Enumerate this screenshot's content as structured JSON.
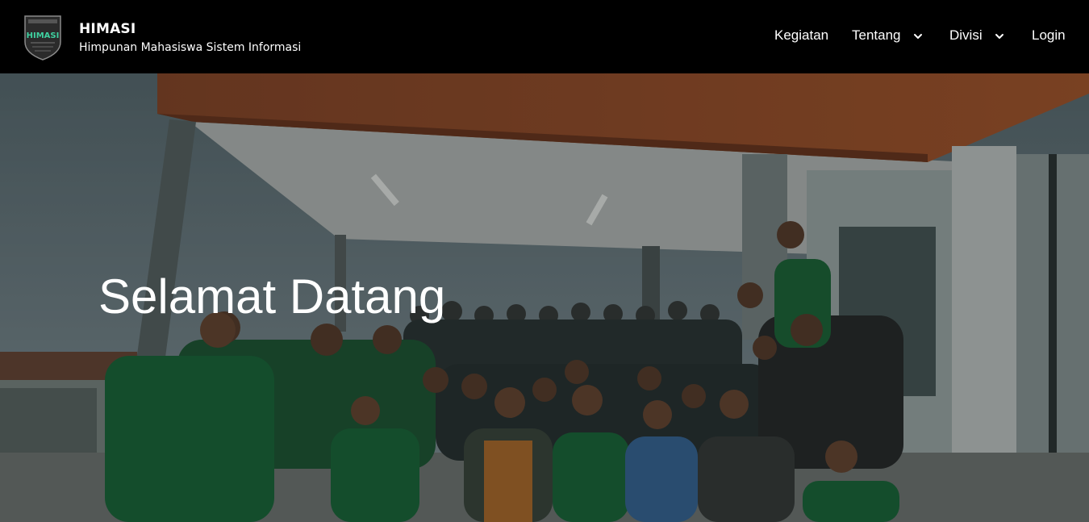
{
  "brand": {
    "title": "HIMASI",
    "subtitle": "Himpunan Mahasiswa Sistem Informasi",
    "logo_icon": "himasi-shield-logo",
    "logo_text": "HIMASI"
  },
  "nav": {
    "items": [
      {
        "label": "Kegiatan",
        "has_dropdown": false
      },
      {
        "label": "Tentang",
        "has_dropdown": true,
        "icon": "chevron-down-icon"
      },
      {
        "label": "Divisi",
        "has_dropdown": true,
        "icon": "chevron-down-icon"
      },
      {
        "label": "Login",
        "has_dropdown": false
      }
    ]
  },
  "hero": {
    "heading": "Selamat Datang",
    "image_description": "group-photo-students-green-shirts",
    "overlay_color": "#000000"
  },
  "colors": {
    "navbar_bg": "#000000",
    "text": "#ffffff",
    "accent_green": "#1f7a3f",
    "roof_orange": "#b8502a"
  }
}
